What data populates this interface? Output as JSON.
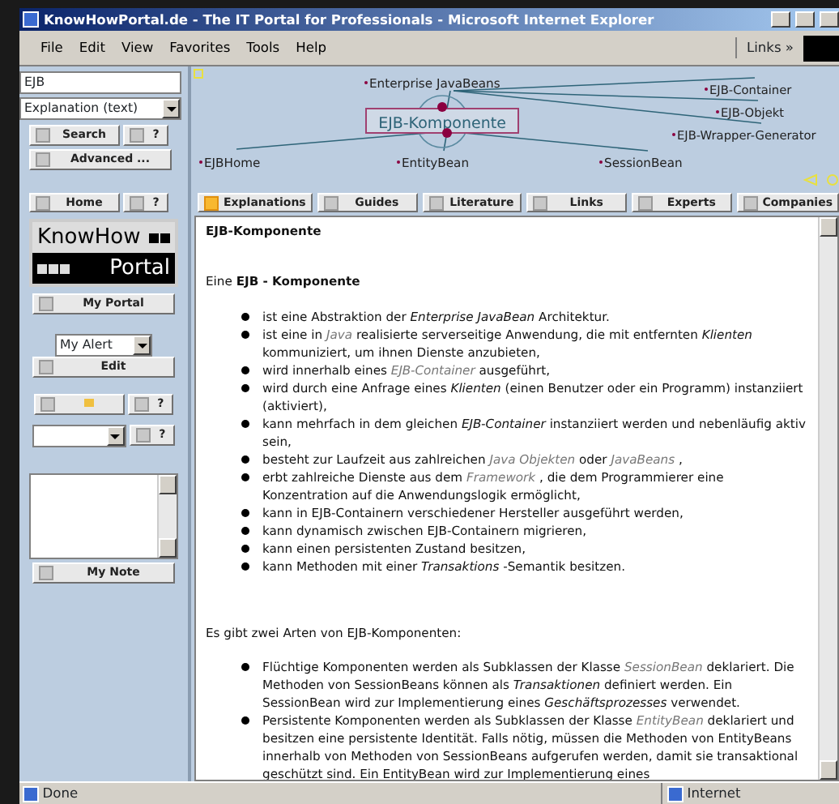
{
  "window": {
    "title": "KnowHowPortal.de - The IT Portal for Professionals - Microsoft Internet Explorer"
  },
  "menu": [
    "File",
    "Edit",
    "View",
    "Favorites",
    "Tools",
    "Help"
  ],
  "links_bar": {
    "label": "Links",
    "chevron": "»"
  },
  "search": {
    "value": "EJB",
    "type_select": "Explanation (text)",
    "search_button": "Search",
    "help_button": "?",
    "advanced_button": "Advanced ..."
  },
  "map": {
    "center": "EJB-Komponente",
    "nodes": [
      {
        "label": "Enterprise JavaBeans",
        "kind": "parent"
      },
      {
        "label": "EJB-Container",
        "kind": "related"
      },
      {
        "label": "EJB-Objekt",
        "kind": "related"
      },
      {
        "label": "EJB-Wrapper-Generator",
        "kind": "related"
      },
      {
        "label": "EJBHome",
        "kind": "child"
      },
      {
        "label": "EntityBean",
        "kind": "child"
      },
      {
        "label": "SessionBean",
        "kind": "child"
      }
    ]
  },
  "nav_buttons": [
    "Home",
    "?"
  ],
  "tabs": [
    {
      "label": "Explanations",
      "selected": true
    },
    {
      "label": "Guides",
      "selected": false
    },
    {
      "label": "Literature",
      "selected": false
    },
    {
      "label": "Links",
      "selected": false
    },
    {
      "label": "Experts",
      "selected": false
    },
    {
      "label": "Companies",
      "selected": false
    }
  ],
  "sidebar": {
    "logo_top": "KnowHow",
    "logo_bottom": "Portal",
    "my_portal": "My Portal",
    "alert_select": "My Alert",
    "edit": "Edit",
    "help_1": "?",
    "help_2": "?",
    "note_button": "My Note"
  },
  "article": {
    "title": "EJB-Komponente",
    "intro": "Eine **EJB - Komponente**",
    "bullets": [
      [
        {
          "kind": "text",
          "text": "ist eine Abstraktion der *Enterprise JavaBean* Architektur."
        }
      ],
      [
        {
          "kind": "text",
          "text": "ist eine in "
        },
        {
          "kind": "link",
          "text": "Java"
        },
        {
          "kind": "text",
          "text": " realisierte serverseitige Anwendung, die mit entfernten *Klienten* kommuniziert, um ihnen Dienste anzubieten,"
        }
      ],
      [
        {
          "kind": "text",
          "text": "wird innerhalb eines "
        },
        {
          "kind": "link",
          "text": "EJB-Container"
        },
        {
          "kind": "text",
          "text": " ausgeführt,"
        }
      ],
      [
        {
          "kind": "text",
          "text": "wird durch eine Anfrage eines *Klienten* (einen Benutzer oder ein Programm) instanziiert (aktiviert),"
        }
      ],
      [
        {
          "kind": "text",
          "text": "kann mehrfach in dem gleichen *EJB-Container* instanziiert werden und nebenläufig aktiv sein,"
        }
      ],
      [
        {
          "kind": "text",
          "text": "besteht zur Laufzeit aus zahlreichen "
        },
        {
          "kind": "link",
          "text": "Java Objekten"
        },
        {
          "kind": "text",
          "text": " oder "
        },
        {
          "kind": "link",
          "text": "JavaBeans"
        },
        {
          "kind": "text",
          "text": " ,"
        }
      ],
      [
        {
          "kind": "text",
          "text": "erbt zahlreiche Dienste aus dem "
        },
        {
          "kind": "link",
          "text": "Framework"
        },
        {
          "kind": "text",
          "text": " , die dem Programmierer eine Konzentration auf die Anwendungslogik ermöglicht,"
        }
      ],
      [
        {
          "kind": "text",
          "text": "kann in EJB-Containern verschiedener Hersteller ausgeführt werden,"
        }
      ],
      [
        {
          "kind": "text",
          "text": "kann dynamisch zwischen EJB-Containern migrieren,"
        }
      ],
      [
        {
          "kind": "text",
          "text": "kann einen persistenten Zustand besitzen,"
        }
      ],
      [
        {
          "kind": "text",
          "text": "kann Methoden mit einer *Transaktions* -Semantik besitzen."
        }
      ]
    ],
    "paragraph": "Es gibt zwei Arten von EJB-Komponenten:",
    "types": [
      [
        {
          "kind": "text",
          "text": "Flüchtige Komponenten werden als Subklassen der Klasse "
        },
        {
          "kind": "link",
          "text": "SessionBean"
        },
        {
          "kind": "text",
          "text": " deklariert. Die Methoden von SessionBeans können als *Transaktionen* definiert werden. Ein SessionBean wird zur Implementierung eines *Geschäftsprozesses* verwendet."
        }
      ],
      [
        {
          "kind": "text",
          "text": "Persistente Komponenten werden als Subklassen der Klasse "
        },
        {
          "kind": "link",
          "text": "EntityBean"
        },
        {
          "kind": "text",
          "text": " deklariert und besitzen eine persistente Identität. Falls nötig, müssen die Methoden von EntityBeans innerhalb von Methoden von SessionBeans aufgerufen werden, damit sie transaktional geschützt sind. Ein EntityBean wird zur Implementierung eines"
        }
      ]
    ]
  },
  "status_bar": {
    "text": "Done",
    "zone": "Internet"
  }
}
